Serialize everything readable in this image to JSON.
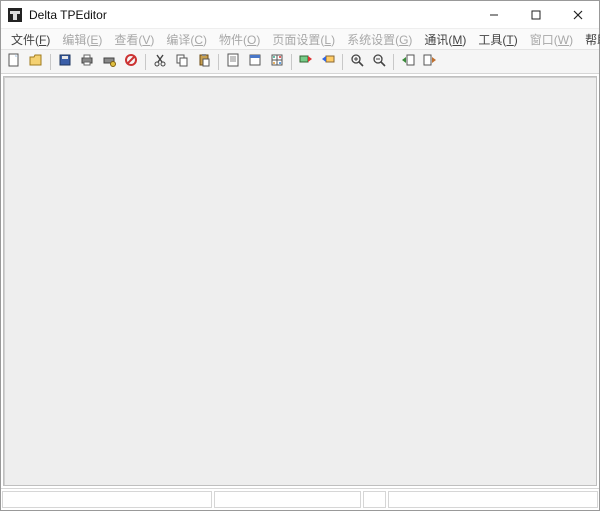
{
  "titlebar": {
    "app_icon": "app-icon",
    "title": "Delta TPEditor"
  },
  "menus": [
    {
      "label": "文件(F)",
      "enabled": true,
      "name": "menu-file"
    },
    {
      "label": "编辑(E)",
      "enabled": false,
      "name": "menu-edit"
    },
    {
      "label": "查看(V)",
      "enabled": false,
      "name": "menu-view"
    },
    {
      "label": "编译(C)",
      "enabled": false,
      "name": "menu-compile"
    },
    {
      "label": "物件(O)",
      "enabled": false,
      "name": "menu-object"
    },
    {
      "label": "页面设置(L)",
      "enabled": false,
      "name": "menu-page-settings"
    },
    {
      "label": "系统设置(G)",
      "enabled": false,
      "name": "menu-system-settings"
    },
    {
      "label": "通讯(M)",
      "enabled": true,
      "name": "menu-communication"
    },
    {
      "label": "工具(T)",
      "enabled": true,
      "name": "menu-tools"
    },
    {
      "label": "窗口(W)",
      "enabled": false,
      "name": "menu-window"
    },
    {
      "label": "帮助(H)",
      "enabled": true,
      "name": "menu-help"
    }
  ],
  "toolbar_groups": [
    [
      "new-doc-icon",
      "open-folder-icon"
    ],
    [
      "save-icon",
      "print-icon",
      "printer-setup-icon",
      "compile-icon"
    ],
    [
      "cut-icon",
      "copy-icon",
      "paste-icon"
    ],
    [
      "page-icon",
      "form-icon",
      "grid-icon"
    ],
    [
      "read-from-tp-icon",
      "upload-to-tp-icon"
    ],
    [
      "zoom-in-icon",
      "zoom-out-icon"
    ],
    [
      "settings-in-icon",
      "settings-out-icon"
    ]
  ],
  "status": {
    "cell1": "",
    "cell2": "",
    "cell3": "",
    "cell4": ""
  }
}
